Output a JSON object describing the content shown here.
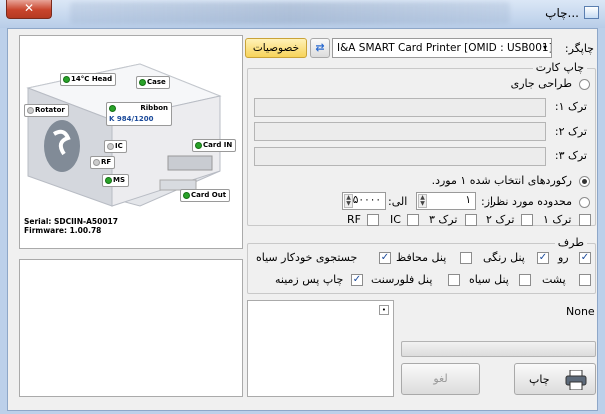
{
  "window": {
    "title": "چاپ..."
  },
  "printer": {
    "label": "چاپگر:",
    "selected": "I&A SMART Card Printer  [OMID : USB001]",
    "properties_label": "خصوصیات"
  },
  "print_card": {
    "group_title": "چاپ کارت",
    "current_design_label": "طراحی جاری",
    "tracks": [
      {
        "label": "ترک ۱:",
        "value": ""
      },
      {
        "label": "ترک ۲:",
        "value": ""
      },
      {
        "label": "ترک ۳:",
        "value": ""
      }
    ],
    "selected_records_label": "رکوردهای انتخاب شده ۱ مورد.",
    "range_label": "محدوده مورد نظر",
    "from_label": "از:",
    "from_value": "۱",
    "to_label": "الی:",
    "to_value": "۵۰۰۰۰",
    "encode_options": [
      {
        "label": "ترک ۱",
        "checked": false
      },
      {
        "label": "ترک ۲",
        "checked": false
      },
      {
        "label": "ترک ۳",
        "checked": false
      },
      {
        "label": "IC",
        "checked": false
      },
      {
        "label": "RF",
        "checked": false
      }
    ]
  },
  "side": {
    "group_title": "طرف",
    "front_label": "رو",
    "back_label": "پشت",
    "front_options": [
      {
        "label": "پنل رنگی",
        "checked": true
      },
      {
        "label": "پنل محافظ",
        "checked": false
      },
      {
        "label": "جستجوی خودکار سیاه",
        "checked": true
      }
    ],
    "back_options": [
      {
        "label": "پنل سیاه",
        "checked": false
      },
      {
        "label": "پنل فلورسنت",
        "checked": false
      },
      {
        "label": "چاپ پس زمینه",
        "checked": true
      }
    ]
  },
  "status": {
    "text": "None",
    "progress": 0
  },
  "buttons": {
    "print": "چاپ",
    "cancel": "لغو"
  },
  "printer_image": {
    "tags": {
      "head": "14°C  Head",
      "case": "Case",
      "rotator": "Rotator",
      "ribbon": "Ribbon",
      "ribbon_count": "K 984/1200",
      "card_in": "Card IN",
      "ic": "IC",
      "rf": "RF",
      "ms": "MS",
      "card_out": "Card Out"
    },
    "serial": "Serial: SDCIIN-A50017",
    "firmware": "Firmware: 1.00.78"
  },
  "colors": {
    "accent_blue": "#1b4a9a",
    "properties_button": "#f7d35a",
    "close_red": "#c8442c"
  }
}
